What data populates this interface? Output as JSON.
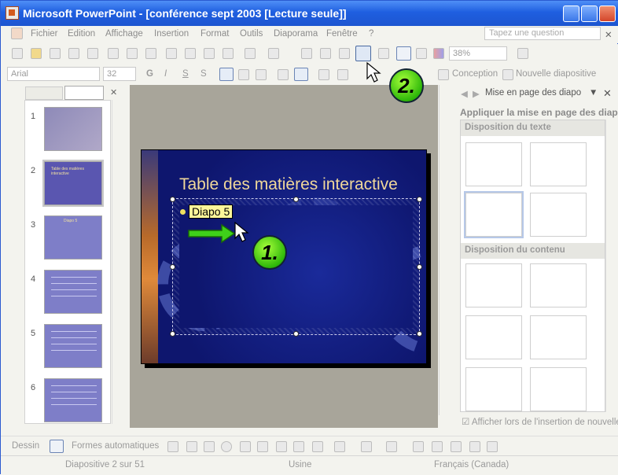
{
  "window": {
    "title": "Microsoft PowerPoint - [conférence sept 2003 [Lecture seule]]"
  },
  "menu": {
    "items": [
      "Fichier",
      "Edition",
      "Affichage",
      "Insertion",
      "Format",
      "Outils",
      "Diaporama",
      "Fenêtre",
      "?"
    ],
    "help_placeholder": "Tapez une question"
  },
  "toolbar": {
    "zoom": "38%",
    "font": "Arial",
    "font_size": "32",
    "bold": "G",
    "italic": "I",
    "underline": "S",
    "shadow": "S",
    "design_label": "Conception",
    "new_slide_label": "Nouvelle diapositive"
  },
  "thumbnails": {
    "numbers": [
      "1",
      "2",
      "3",
      "4",
      "5",
      "6"
    ],
    "slide2_text": "Table des matières interactive",
    "slide3_title": "Diapo 5"
  },
  "slide": {
    "title": "Table des matières interactive",
    "bullet_text": "Diapo 5"
  },
  "annotations": {
    "step1": "1.",
    "step2": "2."
  },
  "taskpane": {
    "title": "Mise en page des diapo",
    "subtitle": "Appliquer la mise en page des diapo",
    "section_text": "Disposition du texte",
    "section_content": "Disposition du contenu",
    "show_on_insert": "Afficher lors de l'insertion de nouvelle"
  },
  "drawing": {
    "label": "Dessin",
    "autoshapes": "Formes automatiques"
  },
  "status": {
    "slide": "Diapositive 2 sur 51",
    "design": "Usine",
    "language": "Français (Canada)"
  },
  "colors": {
    "title_bar": "#1f5fe0",
    "slide_bg": "#0e166e",
    "slide_title": "#f0d89a",
    "badge": "#2fb80a"
  }
}
